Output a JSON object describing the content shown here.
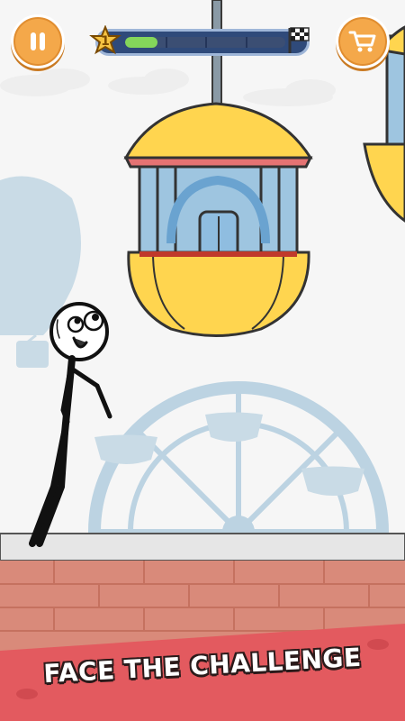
{
  "hud": {
    "level": "1",
    "progress": 0.2,
    "progress_segments": 4
  },
  "banner": {
    "text": "FACE THE CHALLENGE"
  },
  "icons": {
    "pause": "pause-icon",
    "shop": "cart-icon",
    "level_badge": "star-badge-icon",
    "finish": "checkered-flag-icon"
  },
  "colors": {
    "sky": "#f7f7f7",
    "silhouette": "#c9dbe6",
    "button": "#f4a84a",
    "progress_fill": "#84d65a",
    "progress_bg": "#2f4a7a",
    "brick": "#d98a7a",
    "banner": "#e35a5f"
  }
}
